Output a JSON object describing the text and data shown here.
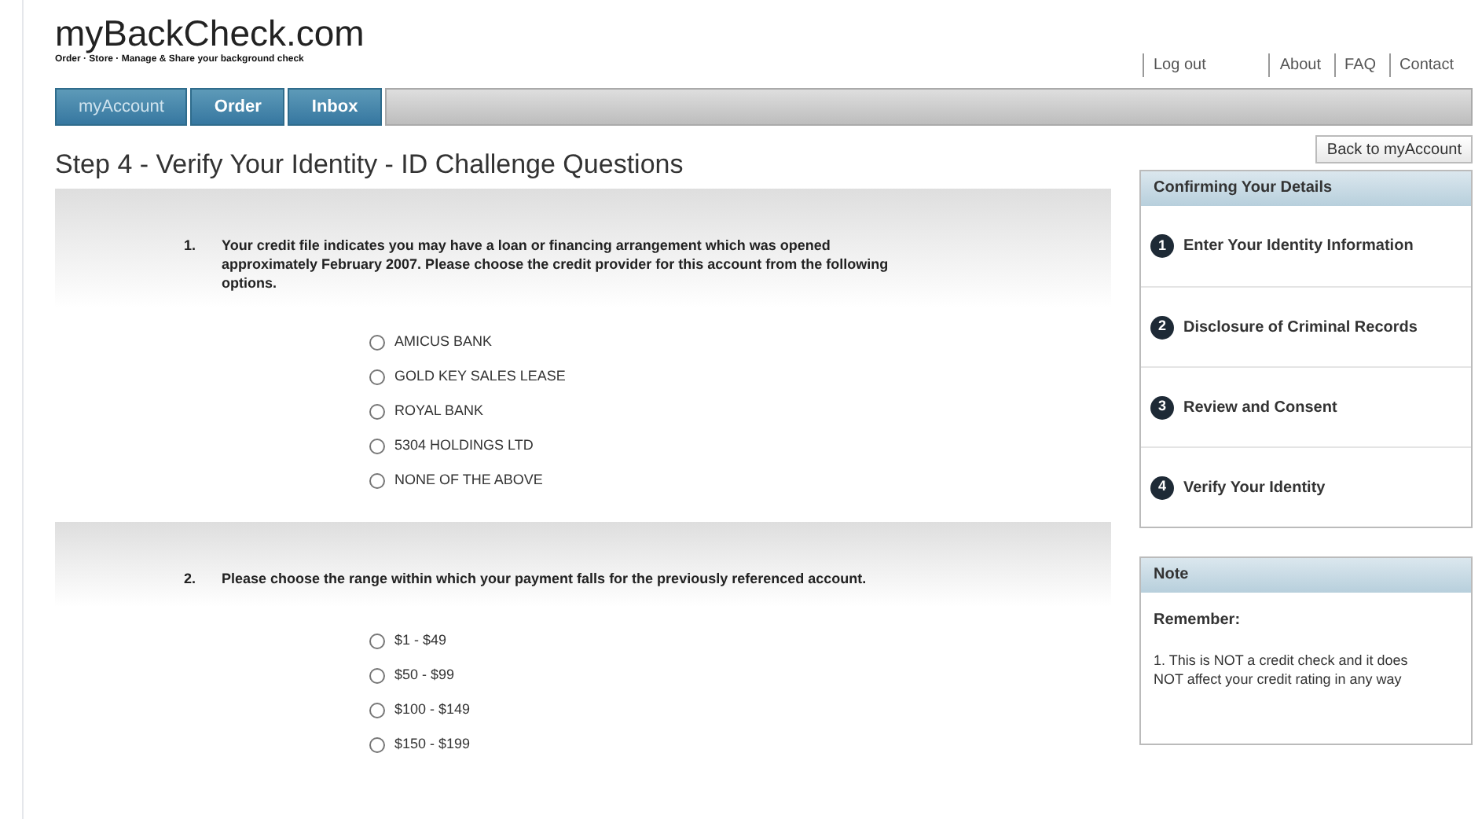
{
  "logo": {
    "title": "myBackCheck.com",
    "tagline": "Order · Store · Manage & Share your background check"
  },
  "top_links": [
    {
      "label": "Log out"
    },
    {
      "label": "About"
    },
    {
      "label": "FAQ"
    },
    {
      "label": "Contact"
    }
  ],
  "tabs": [
    {
      "label": "myAccount",
      "selected": true
    },
    {
      "label": "Order",
      "selected": false
    },
    {
      "label": "Inbox",
      "selected": false
    }
  ],
  "page_title": "Step 4 - Verify Your Identity - ID Challenge Questions",
  "questions": [
    {
      "number": "1.",
      "text": "Your credit file indicates you may have a loan or financing arrangement which was opened approximately February 2007. Please choose the credit provider for this account from the following options.",
      "options": [
        {
          "label": "AMICUS BANK",
          "selected": false
        },
        {
          "label": "GOLD KEY SALES LEASE",
          "selected": false
        },
        {
          "label": "ROYAL BANK",
          "selected": false
        },
        {
          "label": "5304 HOLDINGS LTD",
          "selected": false
        },
        {
          "label": "NONE OF THE ABOVE",
          "selected": false
        }
      ]
    },
    {
      "number": "2.",
      "text": "Please choose the range within which your payment falls for the previously referenced account.",
      "options": [
        {
          "label": "$1 - $49",
          "selected": false
        },
        {
          "label": "$50 - $99",
          "selected": false
        },
        {
          "label": "$100 - $149",
          "selected": false
        },
        {
          "label": "$150 - $199",
          "selected": false
        }
      ]
    }
  ],
  "back_button": "Back to myAccount",
  "steps_panel": {
    "title": "Confirming Your Details",
    "steps": [
      {
        "number": "1",
        "label": "Enter Your Identity Information"
      },
      {
        "number": "2",
        "label": "Disclosure of Criminal Records"
      },
      {
        "number": "3",
        "label": "Review and Consent"
      },
      {
        "number": "4",
        "label": "Verify Your Identity"
      }
    ]
  },
  "note_panel": {
    "title": "Note",
    "heading": "Remember:",
    "text": "1. This is NOT a credit check and it does NOT affect your credit rating in any way"
  }
}
